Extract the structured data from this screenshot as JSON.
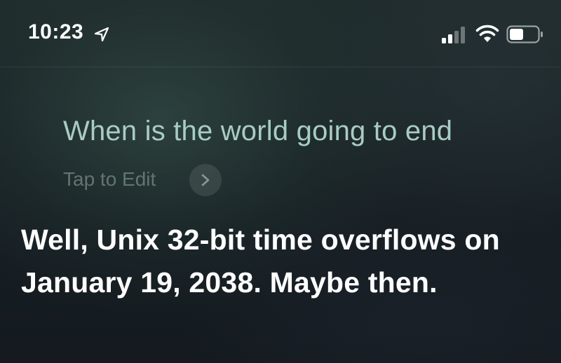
{
  "status_bar": {
    "time": "10:23",
    "location_icon": "location-arrow-icon",
    "signal_icon": "cellular-signal-icon",
    "wifi_icon": "wifi-icon",
    "battery_icon": "battery-icon"
  },
  "siri": {
    "query": "When is the world going to end",
    "edit_label": "Tap to Edit",
    "edit_icon": "chevron-right-icon",
    "response": "Well, Unix 32-bit time overflows on January 19, 2038. Maybe then."
  },
  "colors": {
    "query_text": "#a8ccc2",
    "edit_label": "#62756f",
    "response_text": "#ffffff"
  }
}
